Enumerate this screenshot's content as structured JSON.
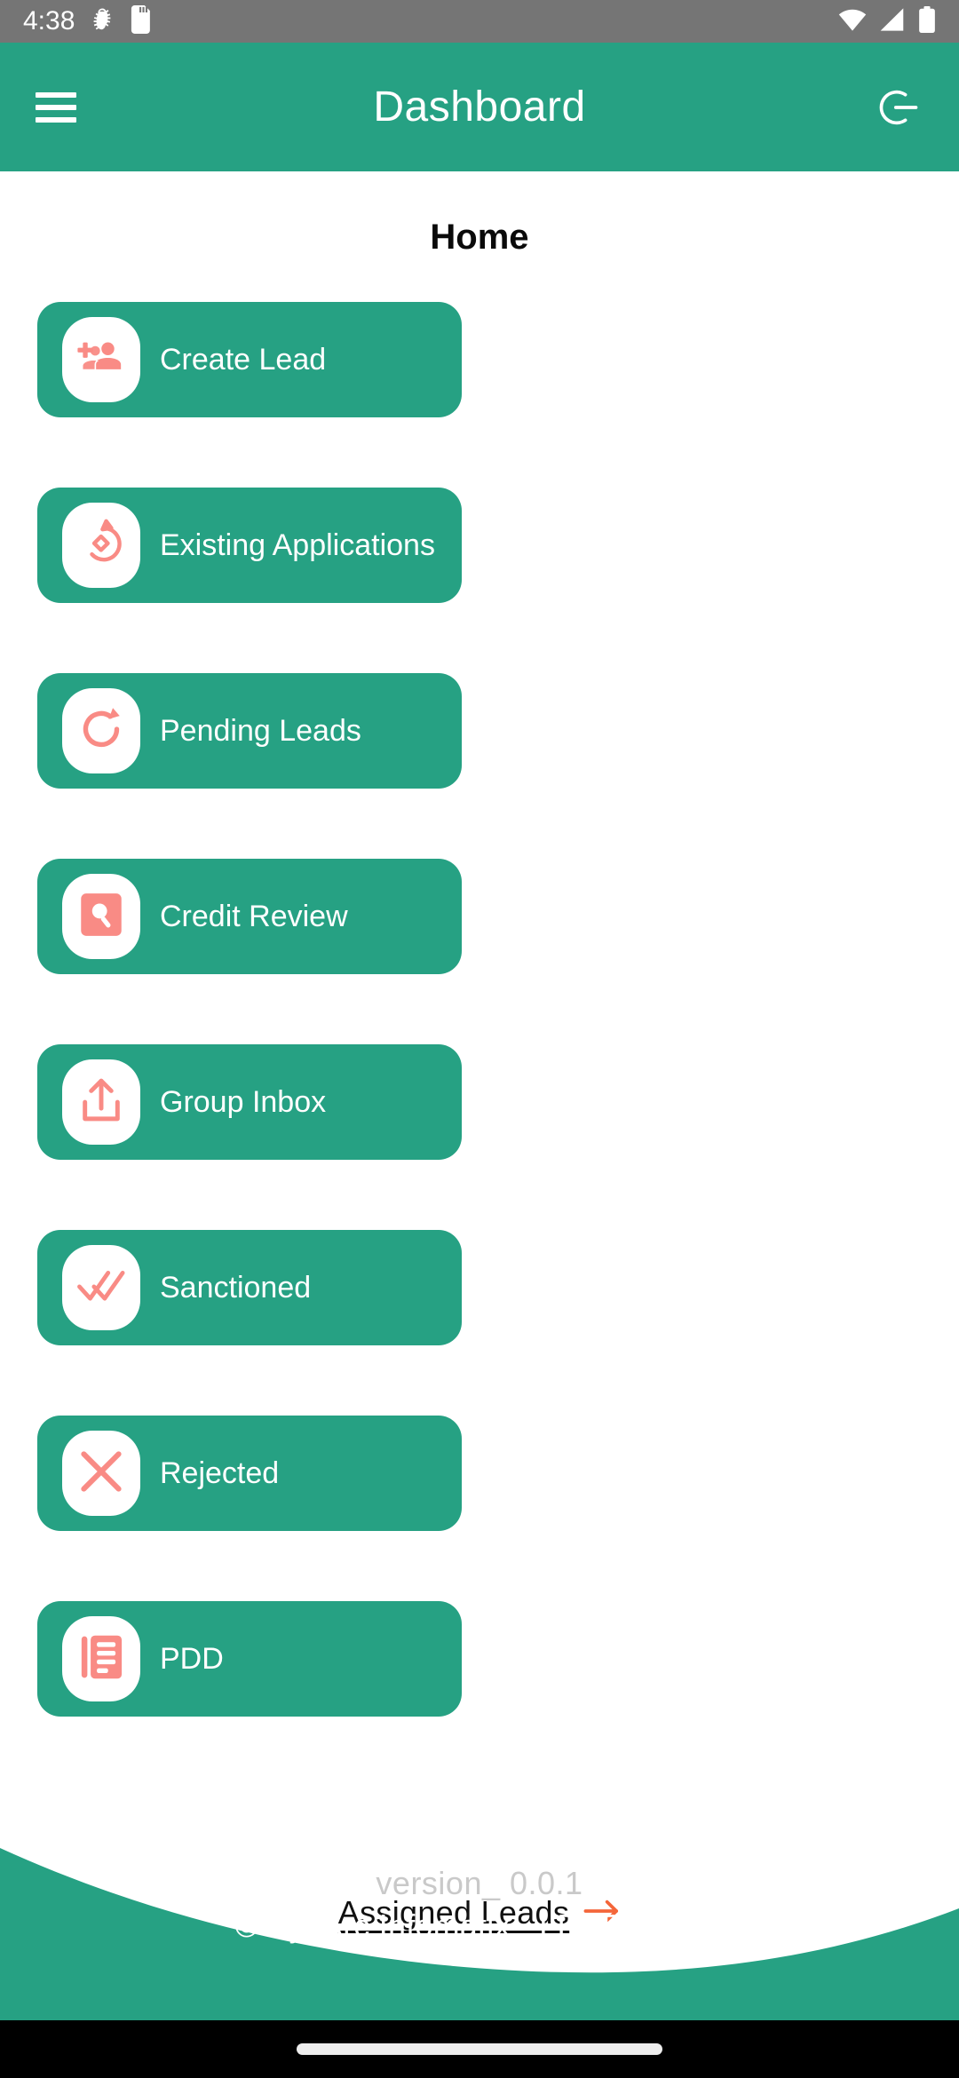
{
  "status_bar": {
    "time": "4:38",
    "left_icons": [
      "bug-debug-icon",
      "sd-card-icon"
    ],
    "right_icons": [
      "wifi-icon",
      "cellular-signal-icon",
      "battery-icon"
    ],
    "background_color": "#757575"
  },
  "app_bar": {
    "title": "Dashboard",
    "menu_icon": "hamburger-menu-icon",
    "logout_icon": "logout-icon",
    "background_color": "#26A183"
  },
  "page": {
    "heading": "Home",
    "background_color": "#FFFFFF"
  },
  "cards": [
    {
      "label": "Create Lead",
      "icon": "add-person-icon"
    },
    {
      "label": "Existing Applications",
      "icon": "rotate-diamond-icon"
    },
    {
      "label": "Pending Leads",
      "icon": "refresh-rotate-icon"
    },
    {
      "label": "Credit Review",
      "icon": "search-box-icon"
    },
    {
      "label": "Group Inbox",
      "icon": "upload-tray-icon"
    },
    {
      "label": "Sanctioned",
      "icon": "double-check-icon"
    },
    {
      "label": "Rejected",
      "icon": "close-x-icon"
    },
    {
      "label": "PDD",
      "icon": "document-list-icon"
    }
  ],
  "assigned_leads": {
    "label": "Assigned Leads ",
    "arrow_icon": "arrow-right-icon",
    "arrow_color": "#F4663A"
  },
  "footer": {
    "version": "version_ 0.0.1",
    "copyright_prefix": "© SysArc Infomatix - LEND",
    "copyright_italic": "perfect",
    "wave_color": "#26A183"
  },
  "theme": {
    "primary_green": "#26A183",
    "icon_salmon": "#F98B85",
    "accent_orange": "#F4663A",
    "status_gray": "#757575",
    "version_gray": "#C9C9C9"
  }
}
